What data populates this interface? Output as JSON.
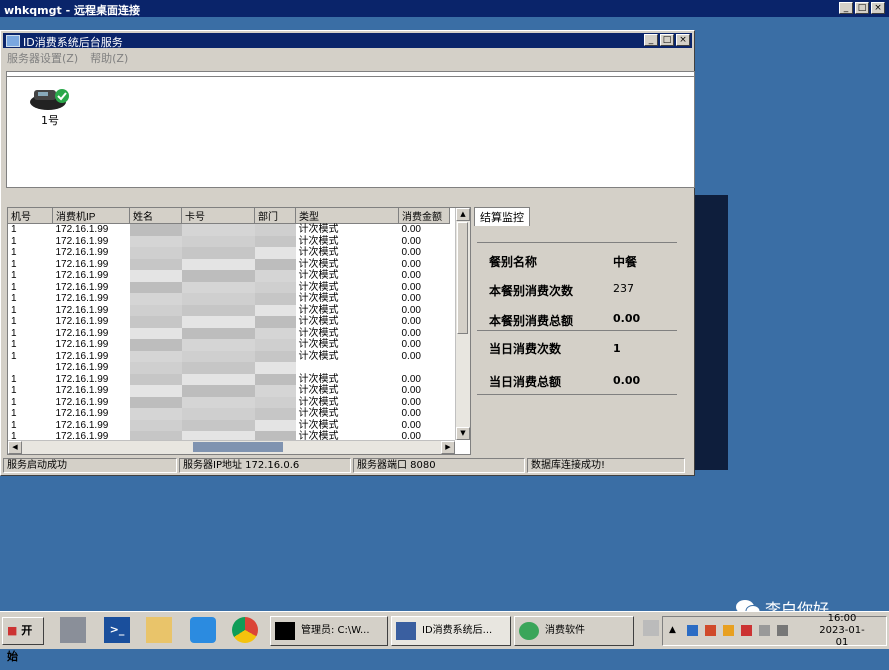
{
  "remote_bar": {
    "title": "whkqmgt - 远程桌面连接",
    "buttons": [
      "_",
      "□",
      "×"
    ]
  },
  "app": {
    "title": "ID消费系统后台服务",
    "buttons": [
      "_",
      "□",
      "×"
    ],
    "menu": [
      "服务器设置(Z)",
      "帮助(Z)"
    ],
    "device": {
      "label": "1号",
      "icon": "pos-terminal-icon"
    }
  },
  "table": {
    "columns": [
      "机号",
      "消费机IP",
      "姓名",
      "卡号",
      "部门",
      "类型",
      "消费金额"
    ],
    "rows": [
      {
        "id": "1",
        "ip": "172.16.1.99",
        "type": "计次模式",
        "amount": "0.00"
      },
      {
        "id": "1",
        "ip": "172.16.1.99",
        "type": "计次模式",
        "amount": "0.00"
      },
      {
        "id": "1",
        "ip": "172.16.1.99",
        "type": "计次模式",
        "amount": "0.00"
      },
      {
        "id": "1",
        "ip": "172.16.1.99",
        "type": "计次模式",
        "amount": "0.00"
      },
      {
        "id": "1",
        "ip": "172.16.1.99",
        "type": "计次模式",
        "amount": "0.00"
      },
      {
        "id": "1",
        "ip": "172.16.1.99",
        "type": "计次模式",
        "amount": "0.00"
      },
      {
        "id": "1",
        "ip": "172.16.1.99",
        "type": "计次模式",
        "amount": "0.00"
      },
      {
        "id": "1",
        "ip": "172.16.1.99",
        "type": "计次模式",
        "amount": "0.00"
      },
      {
        "id": "1",
        "ip": "172.16.1.99",
        "type": "计次模式",
        "amount": "0.00"
      },
      {
        "id": "1",
        "ip": "172.16.1.99",
        "type": "计次模式",
        "amount": "0.00"
      },
      {
        "id": "1",
        "ip": "172.16.1.99",
        "type": "计次模式",
        "amount": "0.00"
      },
      {
        "id": "1",
        "ip": "172.16.1.99",
        "type": "计次模式",
        "amount": "0.00"
      },
      {
        "id": "",
        "ip": "172.16.1.99",
        "type": "",
        "amount": ""
      },
      {
        "id": "1",
        "ip": "172.16.1.99",
        "type": "计次模式",
        "amount": "0.00"
      },
      {
        "id": "1",
        "ip": "172.16.1.99",
        "type": "计次模式",
        "amount": "0.00"
      },
      {
        "id": "1",
        "ip": "172.16.1.99",
        "type": "计次模式",
        "amount": "0.00"
      },
      {
        "id": "1",
        "ip": "172.16.1.99",
        "type": "计次模式",
        "amount": "0.00"
      },
      {
        "id": "1",
        "ip": "172.16.1.99",
        "type": "计次模式",
        "amount": "0.00"
      },
      {
        "id": "1",
        "ip": "172.16.1.99",
        "type": "计次模式",
        "amount": "0.00"
      }
    ]
  },
  "summary_tab": "结算监控",
  "summary": [
    {
      "label": "餐别名称",
      "value": "中餐"
    },
    {
      "label": "本餐别消费次数",
      "value": "237"
    },
    {
      "label": "本餐别消费总额",
      "value": "0.00"
    },
    {
      "label": "当日消费次数",
      "value": "1"
    },
    {
      "label": "当日消费总额",
      "value": "0.00"
    }
  ],
  "status": {
    "msg": "服务启动成功",
    "ip_label": "服务器IP地址   172.16.0.6",
    "port_label": "服务器端口   8080",
    "db": "数据库连接成功!"
  },
  "taskbar": {
    "start": "开始",
    "tasks": [
      "管理员: C:\\W...",
      "ID消费系统后...",
      "消费软件"
    ],
    "clock_time": "16:00",
    "clock_date": "2023-01-01"
  },
  "watermark": "李白你好"
}
